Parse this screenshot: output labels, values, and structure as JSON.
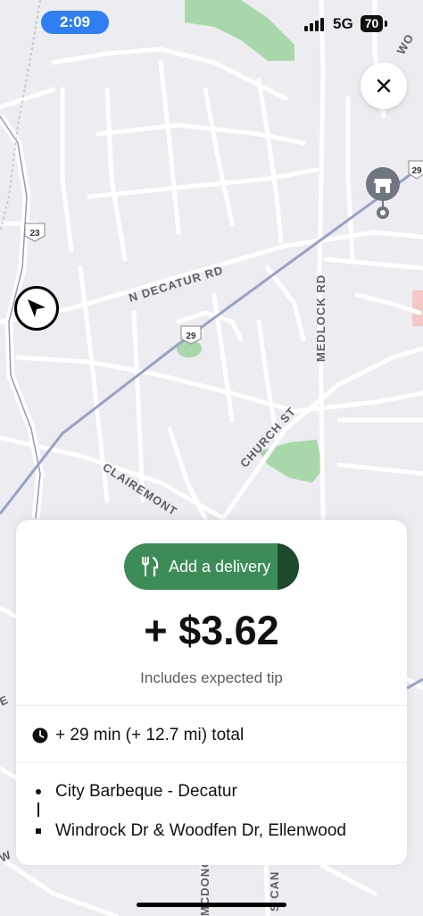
{
  "status_bar": {
    "time": "2:09",
    "network": "5G",
    "battery": "70"
  },
  "map": {
    "street_labels": {
      "n_decatur": "N DECATUR RD",
      "medlock": "MEDLOCK RD",
      "church": "CHURCH ST",
      "clairemont": "CLAIREMONT",
      "mcdonough": "MCDONO",
      "s_candler": "S CAN",
      "partial_e": "E",
      "partial_w": "W",
      "partial_top": "WO"
    },
    "route_shields": {
      "hwy_23": "23",
      "hwy_29_center": "29",
      "hwy_29_right": "29"
    }
  },
  "icons": {
    "close": "close-icon",
    "current_location": "navigation-arrow-icon",
    "store": "store-pin-icon",
    "fork_knife": "fork-knife-icon",
    "clock": "clock-icon"
  },
  "offer": {
    "add_delivery_label": "Add a delivery",
    "price": "+ $3.62",
    "tip_note": "Includes expected tip",
    "duration": "+ 29 min (+ 12.7 mi) total",
    "pickup": "City Barbeque - Decatur",
    "dropoff": "Windrock Dr & Woodfen Dr, Ellenwood"
  },
  "colors": {
    "accent_green": "#3d8c57",
    "accent_green_dark": "#1d4a2c",
    "time_pill": "#2f7ff2",
    "map_background": "#ececf1",
    "park_green": "#a8d8a9",
    "rail_line": "#97a2c6"
  }
}
